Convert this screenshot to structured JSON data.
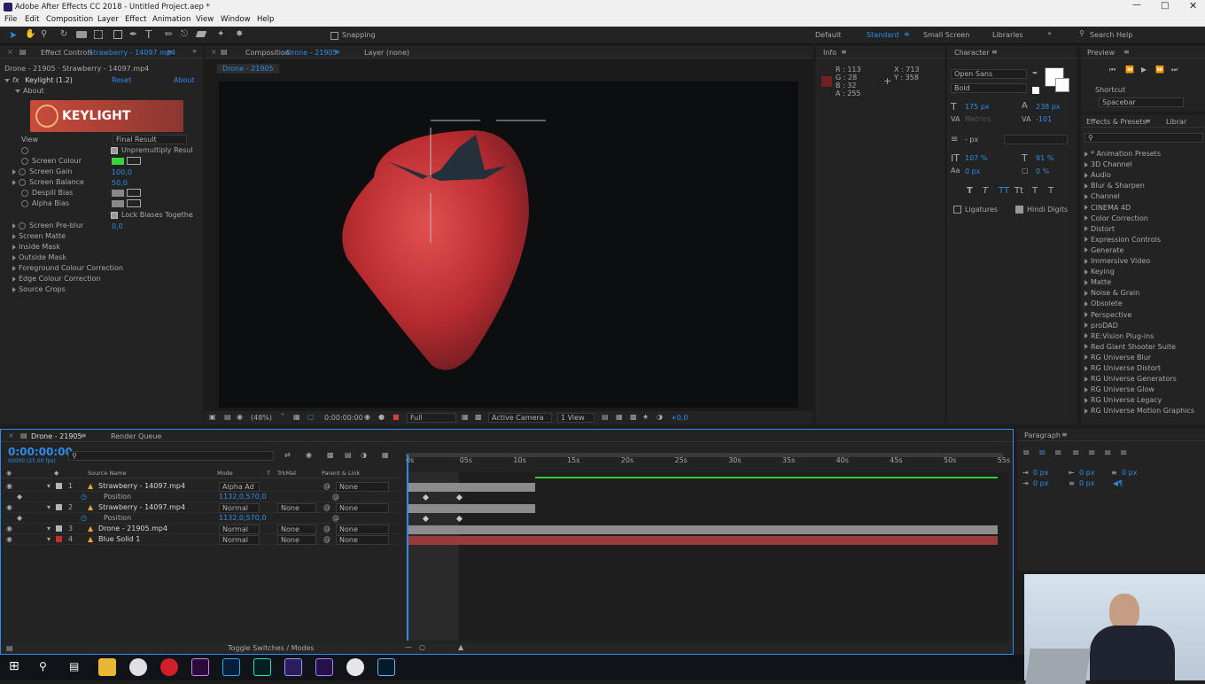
{
  "window": {
    "title": "Adobe After Effects CC 2018 - Untitled Project.aep *"
  },
  "menu": [
    "File",
    "Edit",
    "Composition",
    "Layer",
    "Effect",
    "Animation",
    "View",
    "Window",
    "Help"
  ],
  "toolbar": {
    "snapping": "Snapping",
    "workspaces": [
      "Default",
      "Standard",
      "Small Screen",
      "Libraries"
    ],
    "search_help": "Search Help"
  },
  "effect_controls": {
    "tab": "Effect Controls",
    "tab_layer": "Strawberry - 14097.mp4",
    "breadcrumb": "Drone - 21905 · Strawberry - 14097.mp4",
    "effect_name": "Keylight (1.2)",
    "reset": "Reset",
    "about_link": "About",
    "about": "About",
    "logo_text": "KEYLIGHT",
    "props": [
      {
        "label": "View",
        "value": "Final Result"
      },
      {
        "label": "",
        "value": "Unpremultiply Resul"
      },
      {
        "label": "Screen Colour",
        "value": ""
      },
      {
        "label": "Screen Gain",
        "value": "100,0"
      },
      {
        "label": "Screen Balance",
        "value": "50,0"
      },
      {
        "label": "Despill Bias",
        "value": ""
      },
      {
        "label": "Alpha Bias",
        "value": ""
      },
      {
        "label": "",
        "value": "Lock Biases Togethe"
      },
      {
        "label": "Screen Pre-blur",
        "value": "0,0"
      },
      {
        "label": "Screen Matte",
        "value": ""
      },
      {
        "label": "Inside Mask",
        "value": ""
      },
      {
        "label": "Outside Mask",
        "value": ""
      },
      {
        "label": "Foreground Colour Correction",
        "value": ""
      },
      {
        "label": "Edge Colour Correction",
        "value": ""
      },
      {
        "label": "Source Crops",
        "value": ""
      }
    ]
  },
  "composition": {
    "tab": "Composition",
    "tab_comp": "Drone - 21905",
    "layer_tab": "Layer (none)",
    "sub_tab": "Drone - 21905",
    "zoom": "(48%)",
    "timecode": "0:00:00:00",
    "resolution": "Full",
    "camera": "Active Camera",
    "view": "1 View",
    "offset": "+0,0"
  },
  "info": {
    "title": "Info",
    "r": "R : 113",
    "g": "G : 28",
    "b": "B : 32",
    "a": "A : 255",
    "x": "X : 713",
    "y": "Y : 358",
    "swatch": "#71201f"
  },
  "character": {
    "title": "Character",
    "font": "Open Sans",
    "style": "Bold",
    "size": "175 px",
    "leading": "238 px",
    "kerning": "Metrics",
    "tracking": "-101",
    "stroke": "- px",
    "vscale": "107 %",
    "hscale": "91 %",
    "baseline": "0 px",
    "tsume": "0 %",
    "ligatures": "Ligatures",
    "hindi": "Hindi Digits"
  },
  "preview": {
    "title": "Preview",
    "shortcut_label": "Shortcut",
    "shortcut": "Spacebar"
  },
  "effects_presets": {
    "title": "Effects & Presets",
    "libraries": "Librar",
    "items": [
      "* Animation Presets",
      "3D Channel",
      "Audio",
      "Blur & Sharpen",
      "Channel",
      "CINEMA 4D",
      "Color Correction",
      "Distort",
      "Expression Controls",
      "Generate",
      "Immersive Video",
      "Keying",
      "Matte",
      "Noise & Grain",
      "Obsolete",
      "Perspective",
      "proDAD",
      "RE:Vision Plug-ins",
      "Red Giant Shooter Suite",
      "RG Universe Blur",
      "RG Universe Distort",
      "RG Universe Generators",
      "RG Universe Glow",
      "RG Universe Legacy",
      "RG Universe Motion Graphics"
    ]
  },
  "timeline": {
    "tab": "Drone - 21905",
    "render_queue": "Render Queue",
    "timecode": "0:00:00:00",
    "fps": "00000 (25.00 fps)",
    "headers": {
      "name": "Source Name",
      "mode": "Mode",
      "t": "T",
      "trkmat": "TrkMat",
      "parent": "Parent & Link"
    },
    "ruler": [
      "0s",
      "05s",
      "10s",
      "15s",
      "20s",
      "25s",
      "30s",
      "35s",
      "40s",
      "45s",
      "50s",
      "55s"
    ],
    "layers": [
      {
        "num": "1",
        "name": "Strawberry - 14097.mp4",
        "mode": "Alpha Ad",
        "trkmat": "",
        "parent": "None",
        "color": "#b5b5b5"
      },
      {
        "num": "",
        "name": "Position",
        "mode": "1132,0,570,0",
        "trkmat": "",
        "parent": "",
        "color": ""
      },
      {
        "num": "2",
        "name": "Strawberry - 14097.mp4",
        "mode": "Normal",
        "trkmat": "None",
        "parent": "None",
        "color": "#b5b5b5"
      },
      {
        "num": "",
        "name": "Position",
        "mode": "1132,0,570,0",
        "trkmat": "",
        "parent": "",
        "color": ""
      },
      {
        "num": "3",
        "name": "Drone - 21905.mp4",
        "mode": "Normal",
        "trkmat": "None",
        "parent": "None",
        "color": "#b5b5b5"
      },
      {
        "num": "4",
        "name": "Blue Solid 1",
        "mode": "Normal",
        "trkmat": "None",
        "parent": "None",
        "color": "#c03030"
      }
    ],
    "toggle": "Toggle Switches / Modes"
  },
  "paragraph": {
    "title": "Paragraph",
    "v1": "0 px",
    "v2": "0 px",
    "v3": "0 px",
    "v4": "0 px",
    "v5": "0 px"
  },
  "colors": {
    "accent": "#2d8ceb",
    "green_swatch": "#39d639",
    "strawberry": "#c93a3a"
  }
}
